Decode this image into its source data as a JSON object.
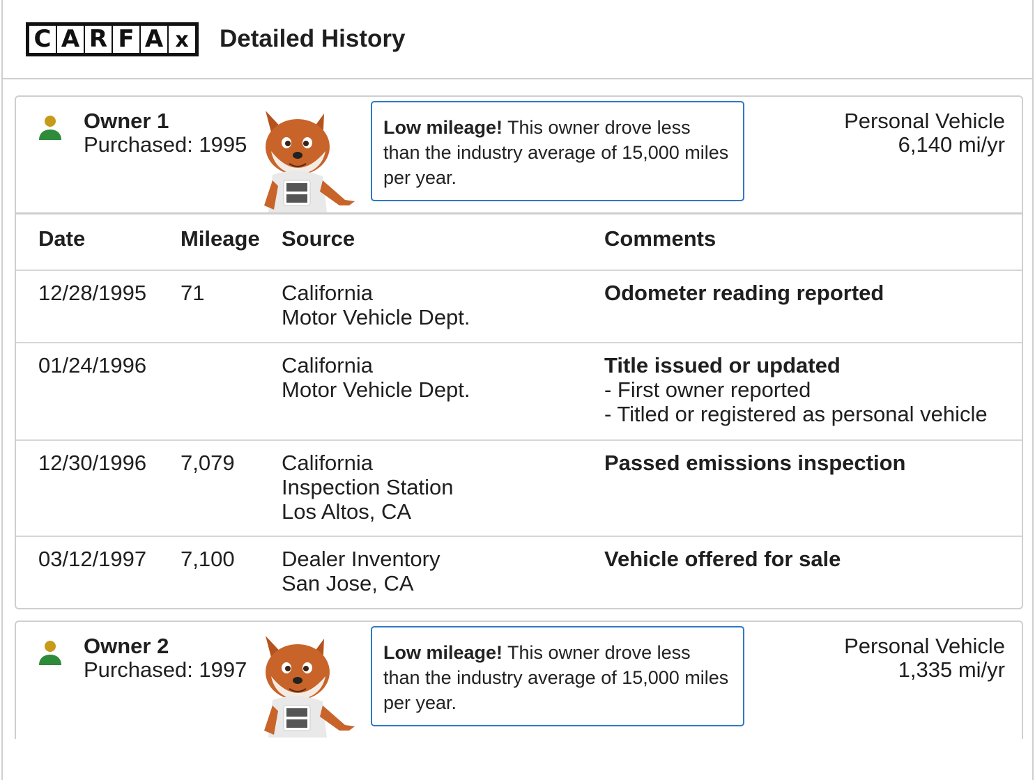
{
  "header": {
    "logo_letters": [
      "C",
      "A",
      "R",
      "F",
      "A",
      "x"
    ],
    "title": "Detailed History"
  },
  "columns": {
    "date": "Date",
    "mileage": "Mileage",
    "source": "Source",
    "comments": "Comments"
  },
  "owners": [
    {
      "name": "Owner 1",
      "purchased": "Purchased: 1995",
      "callout_bold": "Low mileage!",
      "callout_text": " This owner drove less than the industry average of 15,000 miles per year.",
      "vehicle_type": "Personal Vehicle",
      "miles_per_year": "6,140 mi/yr",
      "records": [
        {
          "date": "12/28/1995",
          "mileage": "71",
          "source": [
            "California",
            "Motor Vehicle Dept."
          ],
          "comment_title": "Odometer reading reported",
          "comment_details": []
        },
        {
          "date": "01/24/1996",
          "mileage": "",
          "source": [
            "California",
            "Motor Vehicle Dept."
          ],
          "comment_title": "Title issued or updated",
          "comment_details": [
            "- First owner reported",
            "- Titled or registered as personal vehicle"
          ]
        },
        {
          "date": "12/30/1996",
          "mileage": "7,079",
          "source": [
            "California",
            "Inspection Station",
            "Los Altos, CA"
          ],
          "comment_title": "Passed emissions inspection",
          "comment_details": []
        },
        {
          "date": "03/12/1997",
          "mileage": "7,100",
          "source": [
            "Dealer Inventory",
            "San Jose, CA"
          ],
          "comment_title": "Vehicle offered for sale",
          "comment_details": []
        }
      ]
    },
    {
      "name": "Owner 2",
      "purchased": "Purchased: 1997",
      "callout_bold": "Low mileage!",
      "callout_text": " This owner drove less than the industry average of 15,000 miles per year.",
      "vehicle_type": "Personal Vehicle",
      "miles_per_year": "1,335 mi/yr"
    }
  ],
  "colors": {
    "person_head": "#c79a1a",
    "person_body": "#2e8b3a",
    "callout_border": "#2f78c4",
    "fox_fur": "#c8642a"
  },
  "icons": {
    "owner": "person-icon",
    "mascot": "car-fox-mascot"
  }
}
